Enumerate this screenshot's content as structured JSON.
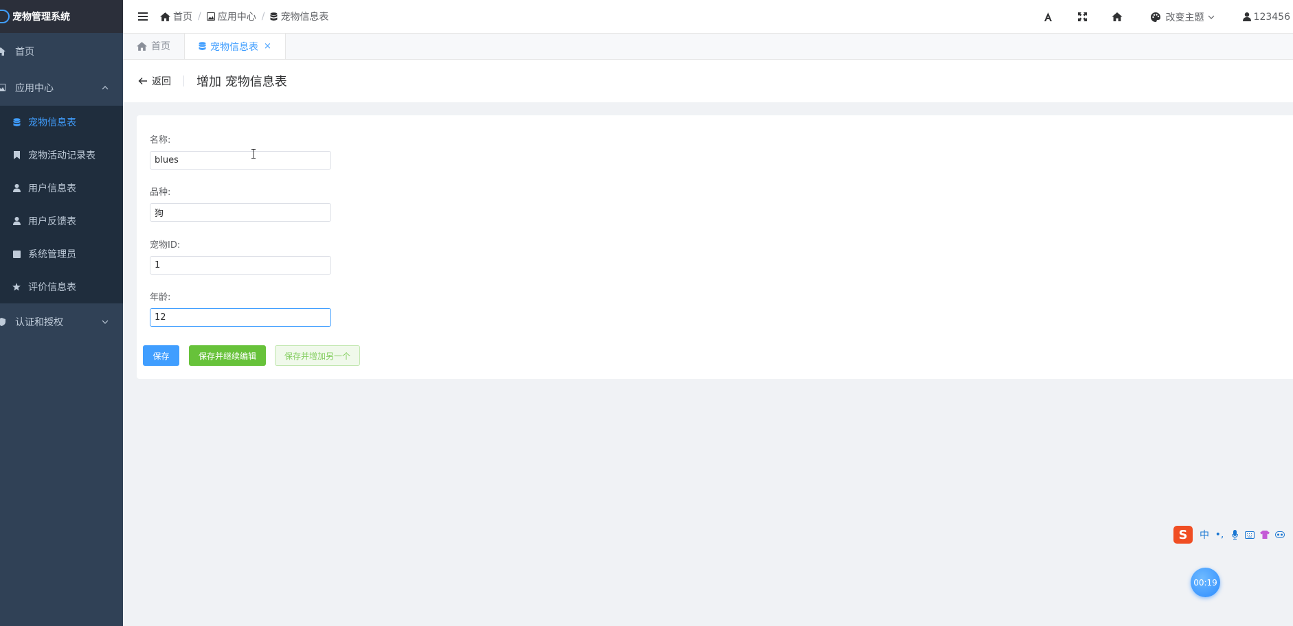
{
  "app": {
    "title": "宠物管理系统"
  },
  "sidebar": {
    "home": "首页",
    "app_center": "应用中心",
    "items": [
      {
        "label": "宠物信息表",
        "icon": "database-icon",
        "active": true
      },
      {
        "label": "宠物活动记录表",
        "icon": "bookmark-icon"
      },
      {
        "label": "用户信息表",
        "icon": "user-icon"
      },
      {
        "label": "用户反馈表",
        "icon": "user-icon"
      },
      {
        "label": "系统管理员",
        "icon": "square-icon"
      },
      {
        "label": "评价信息表",
        "icon": "star-icon"
      }
    ],
    "auth": "认证和授权"
  },
  "navbar": {
    "breadcrumb": [
      "首页",
      "应用中心",
      "宠物信息表"
    ],
    "theme_label": "改变主题",
    "user": "123456"
  },
  "tags": {
    "home": "首页",
    "current": "宠物信息表",
    "close": "×"
  },
  "page_header": {
    "back": "返回",
    "title": "增加 宠物信息表"
  },
  "form": {
    "fields": [
      {
        "label": "名称:",
        "value": "blues"
      },
      {
        "label": "品种:",
        "value": "狗"
      },
      {
        "label": "宠物ID:",
        "value": "1"
      },
      {
        "label": "年龄:",
        "value": "12"
      }
    ],
    "buttons": {
      "save": "保存",
      "save_continue": "保存并继续编辑",
      "save_add": "保存并增加另一个"
    }
  },
  "ime": {
    "logo": "S",
    "lang": "中",
    "punct": "•,"
  },
  "timer": "00:19",
  "colors": {
    "primary": "#409eff",
    "success": "#67c23a",
    "sidebar_bg": "#304156",
    "submenu_bg": "#1f2d3d"
  }
}
